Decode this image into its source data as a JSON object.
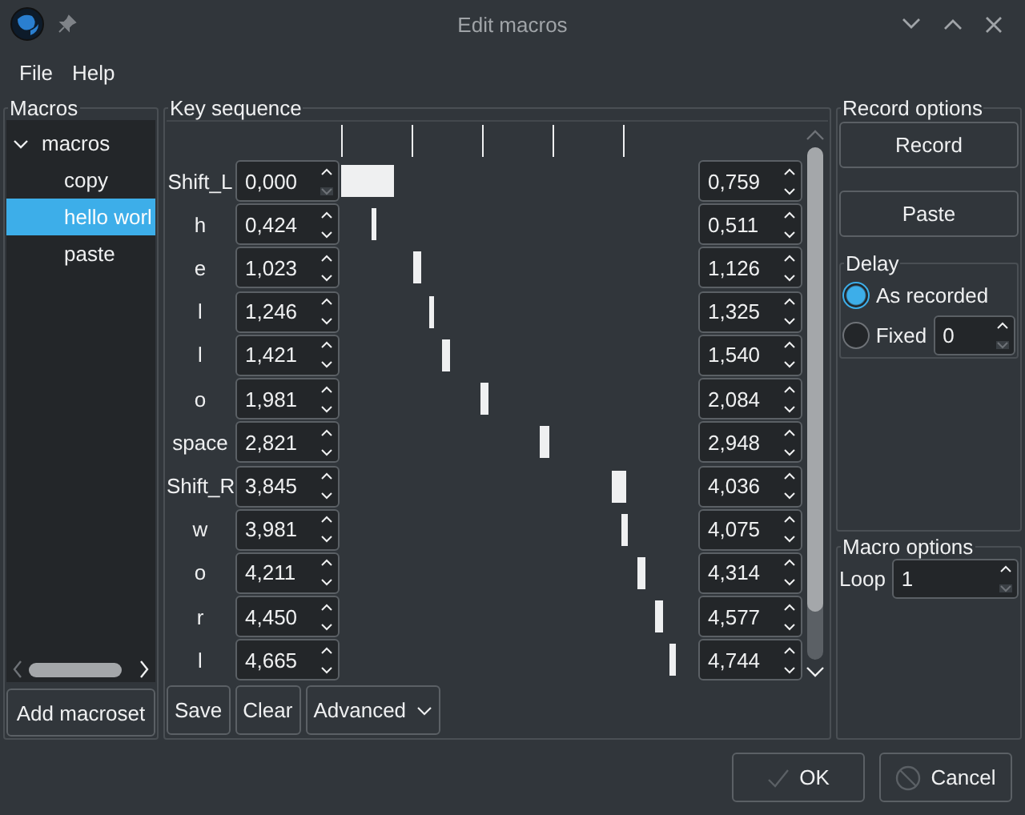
{
  "window": {
    "title": "Edit macros"
  },
  "menu": [
    {
      "label": "File"
    },
    {
      "label": "Help"
    }
  ],
  "macros": {
    "title": "Macros",
    "tree": [
      {
        "label": "macros",
        "expanded": true,
        "selected": false,
        "children": [
          {
            "label": "copy",
            "selected": false
          },
          {
            "label": "hello worl",
            "selected": true
          },
          {
            "label": "paste",
            "selected": false
          }
        ]
      }
    ],
    "add_button": "Add macroset"
  },
  "key_sequence": {
    "title": "Key sequence",
    "rows": [
      {
        "key": "Shift_L",
        "start": {
          "value": "0,000",
          "down_disabled": true
        },
        "end": {
          "value": "0,759",
          "down_disabled": false
        }
      },
      {
        "key": "h",
        "start": {
          "value": "0,424",
          "down_disabled": false
        },
        "end": {
          "value": "0,511",
          "down_disabled": false
        }
      },
      {
        "key": "e",
        "start": {
          "value": "1,023",
          "down_disabled": false
        },
        "end": {
          "value": "1,126",
          "down_disabled": false
        }
      },
      {
        "key": "l",
        "start": {
          "value": "1,246",
          "down_disabled": false
        },
        "end": {
          "value": "1,325",
          "down_disabled": false
        }
      },
      {
        "key": "l",
        "start": {
          "value": "1,421",
          "down_disabled": false
        },
        "end": {
          "value": "1,540",
          "down_disabled": false
        }
      },
      {
        "key": "o",
        "start": {
          "value": "1,981",
          "down_disabled": false
        },
        "end": {
          "value": "2,084",
          "down_disabled": false
        }
      },
      {
        "key": "space",
        "start": {
          "value": "2,821",
          "down_disabled": false
        },
        "end": {
          "value": "2,948",
          "down_disabled": false
        }
      },
      {
        "key": "Shift_R",
        "start": {
          "value": "3,845",
          "down_disabled": false
        },
        "end": {
          "value": "4,036",
          "down_disabled": false
        }
      },
      {
        "key": "w",
        "start": {
          "value": "3,981",
          "down_disabled": false
        },
        "end": {
          "value": "4,075",
          "down_disabled": false
        }
      },
      {
        "key": "o",
        "start": {
          "value": "4,211",
          "down_disabled": false
        },
        "end": {
          "value": "4,314",
          "down_disabled": false
        }
      },
      {
        "key": "r",
        "start": {
          "value": "4,450",
          "down_disabled": false
        },
        "end": {
          "value": "4,577",
          "down_disabled": false
        }
      },
      {
        "key": "l",
        "start": {
          "value": "4,665",
          "down_disabled": false
        },
        "end": {
          "value": "4,744",
          "down_disabled": false
        }
      }
    ],
    "buttons": [
      {
        "label": "Save",
        "kind": "button"
      },
      {
        "label": "Clear",
        "kind": "button"
      },
      {
        "label": "Advanced",
        "kind": "dropdown"
      }
    ]
  },
  "record_options": {
    "title": "Record options",
    "buttons": [
      "Record",
      "Paste"
    ],
    "delay": {
      "title": "Delay",
      "options": [
        {
          "label": "As recorded",
          "selected": true
        },
        {
          "label": "Fixed",
          "selected": false,
          "field": {
            "value": "0",
            "down_disabled": true
          }
        }
      ]
    }
  },
  "macro_options": {
    "title": "Macro options",
    "loop": {
      "label": "Loop",
      "value": "1",
      "down_disabled": true
    }
  },
  "dialog_buttons": [
    {
      "label": "OK",
      "kind": "ok"
    },
    {
      "label": "Cancel",
      "kind": "cancel"
    }
  ]
}
